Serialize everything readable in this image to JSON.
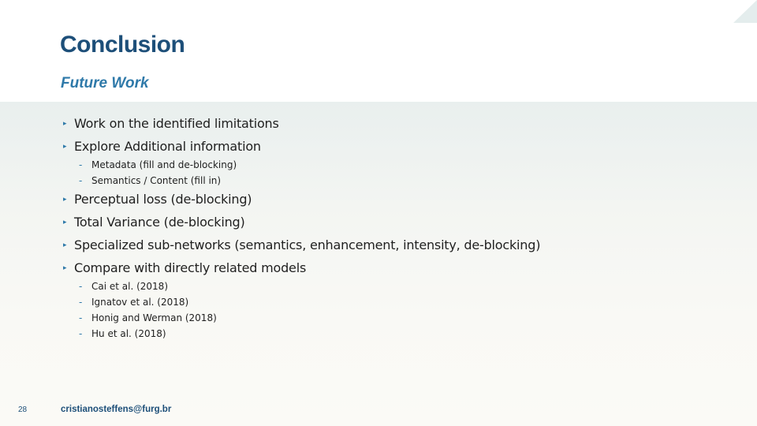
{
  "slide": {
    "title": "Conclusion",
    "subtitle": "Future Work",
    "bullets": [
      {
        "text": "Work on the identified limitations"
      },
      {
        "text": "Explore Additional information",
        "subitems": [
          "Metadata (fill and de-blocking)",
          "Semantics / Content (fill in)"
        ]
      },
      {
        "text": "Perceptual loss (de-blocking)"
      },
      {
        "text": "Total Variance (de-blocking)"
      },
      {
        "text": "Specialized sub-networks (semantics, enhancement, intensity, de-blocking)"
      },
      {
        "text": "Compare with directly related models",
        "subitems": [
          "Cai et al. (2018)",
          "Ignatov et al. (2018)",
          "Honig and Werman (2018)",
          "Hu et al. (2018)"
        ]
      }
    ],
    "bullet_marker": "▸",
    "subitem_marker": "-"
  },
  "footer": {
    "page_number": "28",
    "email": "cristianosteffens@furg.br"
  },
  "colors": {
    "title": "#1d4f79",
    "subtitle": "#2e79a9",
    "accent": "#2e79a9",
    "body_text": "#1f1f1f"
  }
}
